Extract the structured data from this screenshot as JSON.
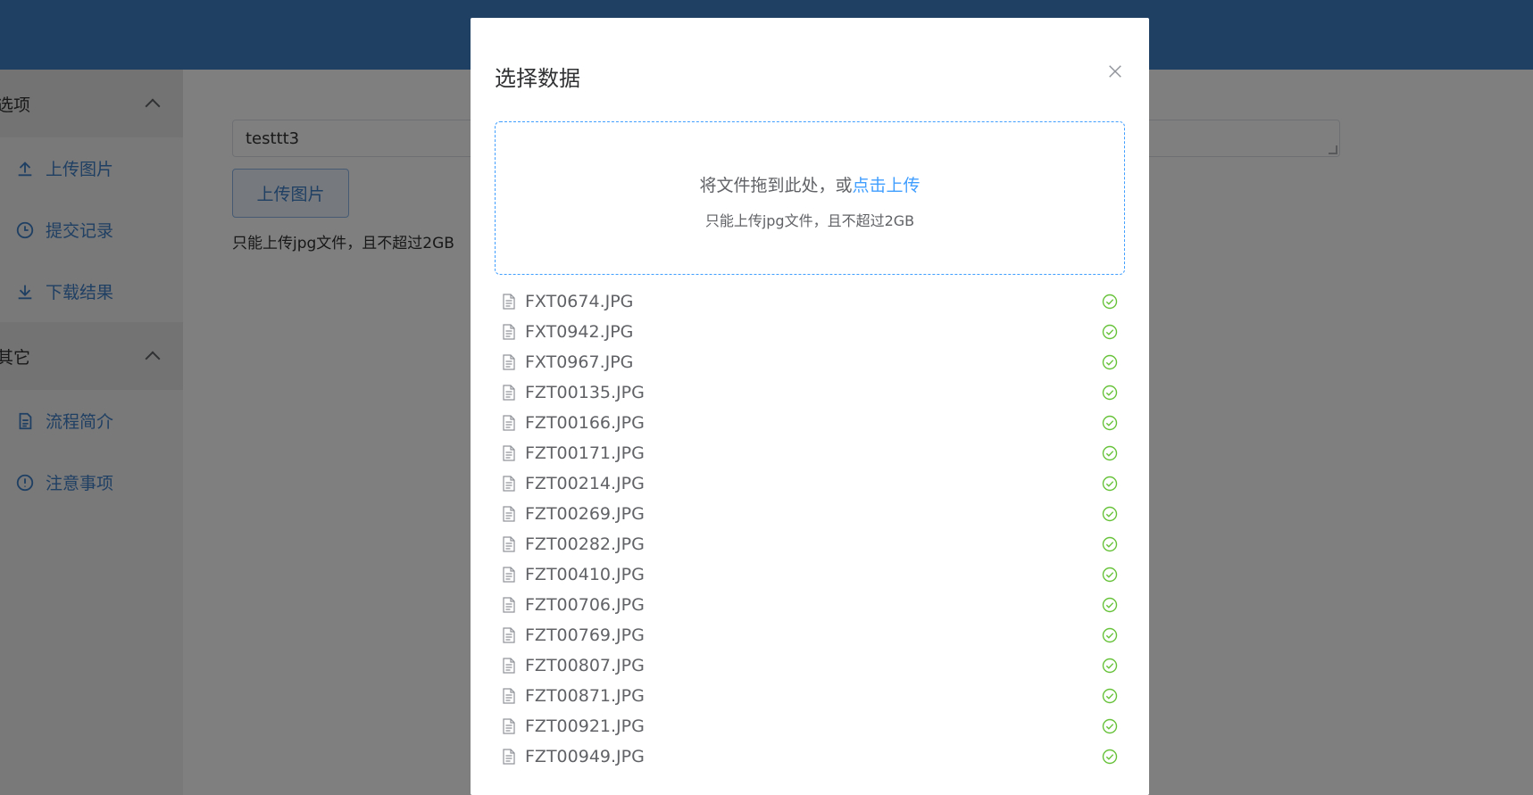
{
  "sidebar": {
    "group1_title": "选项",
    "group1_items": [
      {
        "label": "上传图片",
        "icon": "upload-icon"
      },
      {
        "label": "提交记录",
        "icon": "clock-icon"
      },
      {
        "label": "下载结果",
        "icon": "download-icon"
      }
    ],
    "group2_title": "其它",
    "group2_items": [
      {
        "label": "流程简介",
        "icon": "document-icon"
      },
      {
        "label": "注意事项",
        "icon": "warning-circle-icon"
      }
    ]
  },
  "main": {
    "name_value": "testtt3",
    "upload_button": "上传图片",
    "hint": "只能上传jpg文件，且不超过2GB"
  },
  "dialog": {
    "title": "选择数据",
    "drop_text": "将文件拖到此处，或",
    "drop_link": "点击上传",
    "drop_tip": "只能上传jpg文件，且不超过2GB",
    "files": [
      "FXT0674.JPG",
      "FXT0942.JPG",
      "FXT0967.JPG",
      "FZT00135.JPG",
      "FZT00166.JPG",
      "FZT00171.JPG",
      "FZT00214.JPG",
      "FZT00269.JPG",
      "FZT00282.JPG",
      "FZT00410.JPG",
      "FZT00706.JPG",
      "FZT00769.JPG",
      "FZT00807.JPG",
      "FZT00871.JPG",
      "FZT00921.JPG",
      "FZT00949.JPG"
    ]
  },
  "colors": {
    "topbar": "#3f7ec6",
    "accent": "#409eff",
    "success": "#67c23a"
  }
}
